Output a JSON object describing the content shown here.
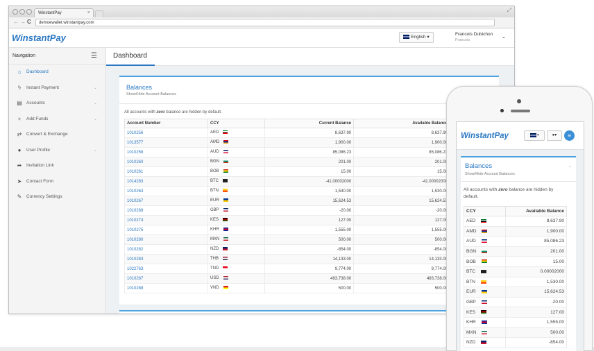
{
  "browser": {
    "tab_title": "WinstantPay",
    "tab_close": "×",
    "url": "demoewallet.winstantpay.com",
    "back": "←",
    "forward": "→",
    "reload": "C",
    "expand": "⤢"
  },
  "header": {
    "logo": "WinstantPay",
    "language": "English",
    "user_name": "Francois Dubichon",
    "user_sub": "Francois"
  },
  "sidebar": {
    "heading": "Navigation",
    "items": [
      {
        "label": "Dashboard",
        "icon": "home-icon",
        "glyph": "⌂",
        "active": true,
        "chevron": ""
      },
      {
        "label": "Instant Payment",
        "icon": "bolt-icon",
        "glyph": "ϟ",
        "active": false,
        "chevron": "⌄"
      },
      {
        "label": "Accounts",
        "icon": "book-icon",
        "glyph": "▤",
        "active": false,
        "chevron": "⌄"
      },
      {
        "label": "Add Funds",
        "icon": "plus-icon",
        "glyph": "+",
        "active": false,
        "chevron": "⌄"
      },
      {
        "label": "Convert & Exchange",
        "icon": "exchange-icon",
        "glyph": "⇄",
        "active": false,
        "chevron": ""
      },
      {
        "label": "User Profile",
        "icon": "user-icon",
        "glyph": "●",
        "active": false,
        "chevron": "⌄"
      },
      {
        "label": "Invitation Link",
        "icon": "share-icon",
        "glyph": "➦",
        "active": false,
        "chevron": ""
      },
      {
        "label": "Contact Form",
        "icon": "send-icon",
        "glyph": "➤",
        "active": false,
        "chevron": ""
      },
      {
        "label": "Currency Settings",
        "icon": "wrench-icon",
        "glyph": "✎",
        "active": false,
        "chevron": ""
      }
    ]
  },
  "main": {
    "page_title": "Dashboard",
    "panel_title": "Balances",
    "panel_subtitle": "Show/Hide Account Balances",
    "note_prefix": "All accounts with ",
    "note_em": "zero",
    "note_suffix": " balance are hidden by default.",
    "columns": [
      "Account Number",
      "CCY",
      "Current Balance",
      "Available Balance"
    ],
    "rows": [
      {
        "account": "1010256",
        "ccy": "AED",
        "flag": [
          "#00732f",
          "#ffffff",
          "#000000",
          "#ff0000"
        ],
        "current": "8,637.90",
        "available": "8,637.90"
      },
      {
        "account": "1013577",
        "ccy": "AMD",
        "flag": [
          "#d90012",
          "#0033a0",
          "#f2a800"
        ],
        "current": "1,900.00",
        "available": "1,900.00"
      },
      {
        "account": "1010258",
        "ccy": "AUD",
        "flag": [
          "#012169",
          "#ffffff",
          "#e4002b"
        ],
        "current": "85,086.23",
        "available": "85,086.23"
      },
      {
        "account": "1010260",
        "ccy": "BGN",
        "flag": [
          "#ffffff",
          "#00966e",
          "#d62612"
        ],
        "current": "201.00",
        "available": "201.00"
      },
      {
        "account": "1010261",
        "ccy": "BOB",
        "flag": [
          "#d52b1e",
          "#f9e300",
          "#007934"
        ],
        "current": "15.00",
        "available": "15.00"
      },
      {
        "account": "1014283",
        "ccy": "BTC",
        "flag": [
          "#222222"
        ],
        "current": "-41.00002000",
        "available": "-41.00002000"
      },
      {
        "account": "1010263",
        "ccy": "BTN",
        "flag": [
          "#ffd520",
          "#ff4e12"
        ],
        "current": "1,530.00",
        "available": "1,530.00"
      },
      {
        "account": "1010267",
        "ccy": "EUR",
        "flag": [
          "#003399",
          "#ffcc00"
        ],
        "current": "15,624.53",
        "available": "15,624.53"
      },
      {
        "account": "1010268",
        "ccy": "GBP",
        "flag": [
          "#012169",
          "#ffffff",
          "#c8102e"
        ],
        "current": "-20.00",
        "available": "-20.00"
      },
      {
        "account": "1010274",
        "ccy": "KES",
        "flag": [
          "#000000",
          "#bb0000",
          "#006600"
        ],
        "current": "127.00",
        "available": "127.00"
      },
      {
        "account": "1010275",
        "ccy": "KHR",
        "flag": [
          "#032ea1",
          "#e00025",
          "#032ea1"
        ],
        "current": "1,555.00",
        "available": "1,555.00"
      },
      {
        "account": "1010280",
        "ccy": "MXN",
        "flag": [
          "#006847",
          "#ffffff",
          "#ce1126"
        ],
        "current": "500.00",
        "available": "500.00"
      },
      {
        "account": "1010282",
        "ccy": "NZD",
        "flag": [
          "#012169",
          "#c8102e"
        ],
        "current": "-854.00",
        "available": "-854.00"
      },
      {
        "account": "1010283",
        "ccy": "THB",
        "flag": [
          "#a51931",
          "#f4f5f8",
          "#2d2a4a"
        ],
        "current": "14,133.00",
        "available": "14,133.00"
      },
      {
        "account": "1022763",
        "ccy": "TND",
        "flag": [
          "#e70013",
          "#ffffff"
        ],
        "current": "9,774.00",
        "available": "9,774.00"
      },
      {
        "account": "1010287",
        "ccy": "USD",
        "flag": [
          "#b22234",
          "#ffffff",
          "#3c3b6e"
        ],
        "current": "493,738.00",
        "available": "493,738.00"
      },
      {
        "account": "1010288",
        "ccy": "VND",
        "flag": [
          "#da251d",
          "#ffff00"
        ],
        "current": "500.00",
        "available": "500.00"
      }
    ]
  },
  "mobile": {
    "logo": "WinstantPay",
    "panel_title": "Balances",
    "panel_subtitle": "Show/Hide Account Balances",
    "panel_caret": "⌄",
    "note_prefix": "All accounts with ",
    "note_em": "zero",
    "note_suffix": " balance are hidden by default.",
    "columns": [
      "CCY",
      "Available Balance"
    ],
    "rows": [
      {
        "ccy": "AED",
        "flag": [
          "#00732f",
          "#ffffff",
          "#000000",
          "#ff0000"
        ],
        "available": "8,637.90"
      },
      {
        "ccy": "AMD",
        "flag": [
          "#d90012",
          "#0033a0",
          "#f2a800"
        ],
        "available": "1,900.00"
      },
      {
        "ccy": "AUD",
        "flag": [
          "#012169",
          "#ffffff",
          "#e4002b"
        ],
        "available": "85,086.23"
      },
      {
        "ccy": "BGN",
        "flag": [
          "#ffffff",
          "#00966e",
          "#d62612"
        ],
        "available": "201.00"
      },
      {
        "ccy": "BOB",
        "flag": [
          "#d52b1e",
          "#f9e300",
          "#007934"
        ],
        "available": "15.00"
      },
      {
        "ccy": "BTC",
        "flag": [
          "#222222"
        ],
        "available": "0.00002000"
      },
      {
        "ccy": "BTN",
        "flag": [
          "#ffd520",
          "#ff4e12"
        ],
        "available": "1,530.00"
      },
      {
        "ccy": "EUR",
        "flag": [
          "#003399",
          "#ffcc00"
        ],
        "available": "15,624.53"
      },
      {
        "ccy": "GBP",
        "flag": [
          "#012169",
          "#ffffff",
          "#c8102e"
        ],
        "available": "-20.00"
      },
      {
        "ccy": "KES",
        "flag": [
          "#000000",
          "#bb0000",
          "#006600"
        ],
        "available": "127.00"
      },
      {
        "ccy": "KHR",
        "flag": [
          "#032ea1",
          "#e00025",
          "#032ea1"
        ],
        "available": "1,555.00"
      },
      {
        "ccy": "MXN",
        "flag": [
          "#006847",
          "#ffffff",
          "#ce1126"
        ],
        "available": "500.00"
      },
      {
        "ccy": "NZD",
        "flag": [
          "#012169",
          "#c8102e"
        ],
        "available": "-854.00"
      }
    ]
  },
  "colors": {
    "brand": "#2b78c2",
    "accent_line": "#4aa3df",
    "menu_button": "#3b8fd6"
  }
}
